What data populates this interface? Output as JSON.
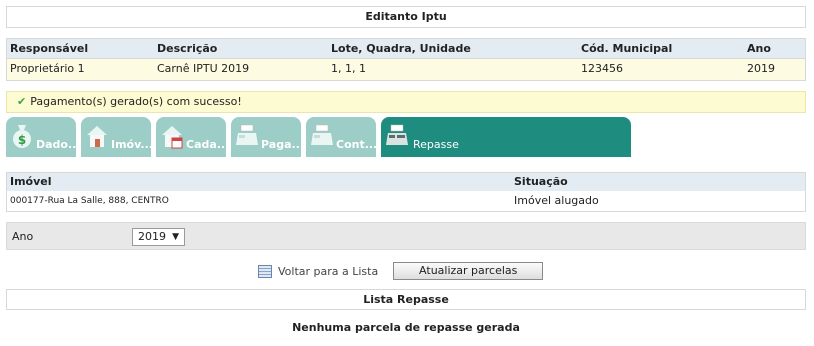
{
  "page": {
    "title": "Editanto Iptu"
  },
  "info": {
    "headers": [
      "Responsável",
      "Descrição",
      "Lote, Quadra, Unidade",
      "Cód. Municipal",
      "Ano"
    ],
    "row": [
      "Proprietário 1",
      "Carnê IPTU 2019",
      "1, 1, 1",
      "123456",
      "2019"
    ]
  },
  "message": {
    "text": "Pagamento(s) gerado(s) com sucesso!",
    "icon": "check-icon"
  },
  "tabs": [
    {
      "label": "Dado...",
      "icon": "money-bag-icon",
      "active": false
    },
    {
      "label": "Imóv...",
      "icon": "house-icon",
      "active": false
    },
    {
      "label": "Cada...",
      "icon": "house-calendar-icon",
      "active": false
    },
    {
      "label": "Paga...",
      "icon": "cash-register-icon",
      "active": false
    },
    {
      "label": "Cont...",
      "icon": "cash-register-icon",
      "active": false
    },
    {
      "label": "Repasse",
      "icon": "cash-register-icon",
      "active": true
    }
  ],
  "imovel": {
    "headers": [
      "Imóvel",
      "Situação"
    ],
    "row": [
      "000177-Rua La Salle, 888, CENTRO",
      "Imóvel alugado"
    ]
  },
  "filter": {
    "label": "Ano",
    "selected": "2019",
    "arrow": "▼"
  },
  "actions": {
    "back_label": "Voltar para a Lista",
    "update_label": "Atualizar parcelas"
  },
  "list": {
    "title": "Lista Repasse",
    "empty_message": "Nenhuma parcela de repasse gerada"
  },
  "colors": {
    "tab_active": "#1f8c80",
    "tab_inactive": "#9ccdc6",
    "header_bg": "#e4ecf3",
    "row_bg": "#fdfbe2",
    "message_bg": "#fdfbd2"
  }
}
